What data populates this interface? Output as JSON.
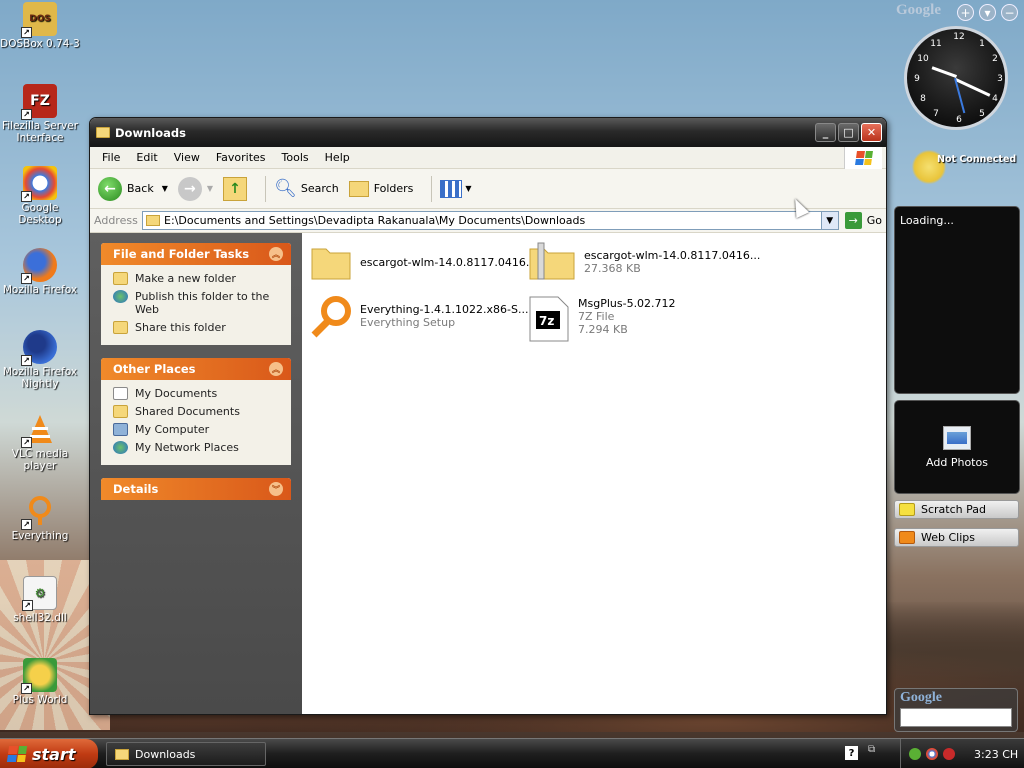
{
  "desktop": {
    "icons": [
      {
        "label": "DOSBox 0.74-3",
        "icon": "dosbox-icon"
      },
      {
        "label": "Filezilla Server Interface",
        "icon": "filezilla-icon"
      },
      {
        "label": "Google Desktop",
        "icon": "google-desktop-icon"
      },
      {
        "label": "Mozilla Firefox",
        "icon": "firefox-icon"
      },
      {
        "label": "Mozilla Firefox Nightly",
        "icon": "firefox-nightly-icon"
      },
      {
        "label": "VLC media player",
        "icon": "vlc-icon"
      },
      {
        "label": "Everything",
        "icon": "everything-icon"
      },
      {
        "label": "shell32.dll",
        "icon": "dll-icon"
      },
      {
        "label": "Plus World",
        "icon": "plus-world-icon"
      }
    ]
  },
  "window": {
    "title": "Downloads",
    "menu": [
      "File",
      "Edit",
      "View",
      "Favorites",
      "Tools",
      "Help"
    ],
    "toolbar": {
      "back": "Back",
      "search": "Search",
      "folders": "Folders"
    },
    "address": {
      "label": "Address",
      "value": "E:\\Documents and Settings\\Devadipta Rakanuala\\My Documents\\Downloads",
      "go": "Go"
    },
    "tasks_panel": {
      "title": "File and Folder Tasks",
      "items": [
        "Make a new folder",
        "Publish this folder to the Web",
        "Share this folder"
      ]
    },
    "places_panel": {
      "title": "Other Places",
      "items": [
        "My Documents",
        "Shared Documents",
        "My Computer",
        "My Network Places"
      ]
    },
    "details_panel": {
      "title": "Details"
    },
    "files": [
      {
        "name": "escargot-wlm-14.0.8117.0416...",
        "type": "",
        "size": "",
        "icon": "folder-icon"
      },
      {
        "name": "escargot-wlm-14.0.8117.0416...",
        "type": "",
        "size": "27.368 KB",
        "icon": "zip-folder-icon"
      },
      {
        "name": "Everything-1.4.1.1022.x86-S...",
        "type": "Everything Setup",
        "size": "",
        "icon": "everything-setup-icon"
      },
      {
        "name": "MsgPlus-5.02.712",
        "type": "7Z File",
        "size": "7.294 KB",
        "icon": "7z-file-icon"
      }
    ]
  },
  "sidebar": {
    "google_label": "Google",
    "not_connected": "Not Connected",
    "loading": "Loading...",
    "add_photos": "Add Photos",
    "scratch_pad": "Scratch Pad",
    "web_clips": "Web Clips",
    "google_search_label": "Google"
  },
  "taskbar": {
    "start": "start",
    "task_button": "Downloads",
    "clock": "3:23 CH"
  }
}
